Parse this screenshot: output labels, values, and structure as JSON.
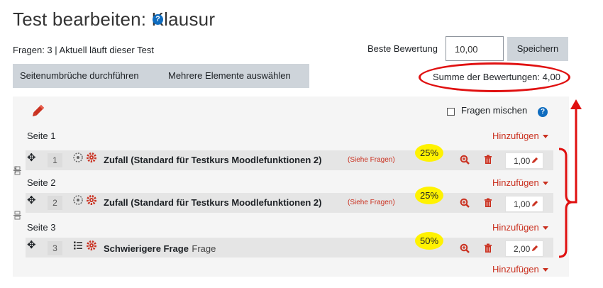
{
  "header": {
    "title": "Test bearbeiten: Klausur",
    "info": "Fragen: 3 | Aktuell läuft dieser Test",
    "grade_label": "Beste Bewertung",
    "grade_value": "10,00",
    "save_label": "Speichern"
  },
  "toolbar": {
    "repaginate_label": "Seitenumbrüche durchführen",
    "select_multiple_label": "Mehrere Elemente auswählen"
  },
  "total_marks": "Summe der Bewertungen: 4,00",
  "shuffle_label": "Fragen mischen",
  "add_label": "Hinzufügen",
  "pages": [
    {
      "label": "Seite 1"
    },
    {
      "label": "Seite 2"
    },
    {
      "label": "Seite 3"
    }
  ],
  "questions": [
    {
      "number": "1",
      "title": "Zufall (Standard für Testkurs Moodlefunktionen 2)",
      "extra": "(Siehe Fragen)",
      "mark": "1,00",
      "percent": "25%"
    },
    {
      "number": "2",
      "title": "Zufall (Standard für Testkurs Moodlefunktionen 2)",
      "extra": "(Siehe Fragen)",
      "mark": "1,00",
      "percent": "25%"
    },
    {
      "number": "3",
      "title": "Schwierigere Frage",
      "type": "Frage",
      "mark": "2,00",
      "percent": "50%"
    }
  ],
  "colors": {
    "accent_red": "#ca3120",
    "annotation_red": "#e01010",
    "highlight_yellow": "#fff200",
    "help_blue": "#0f6cbf"
  }
}
